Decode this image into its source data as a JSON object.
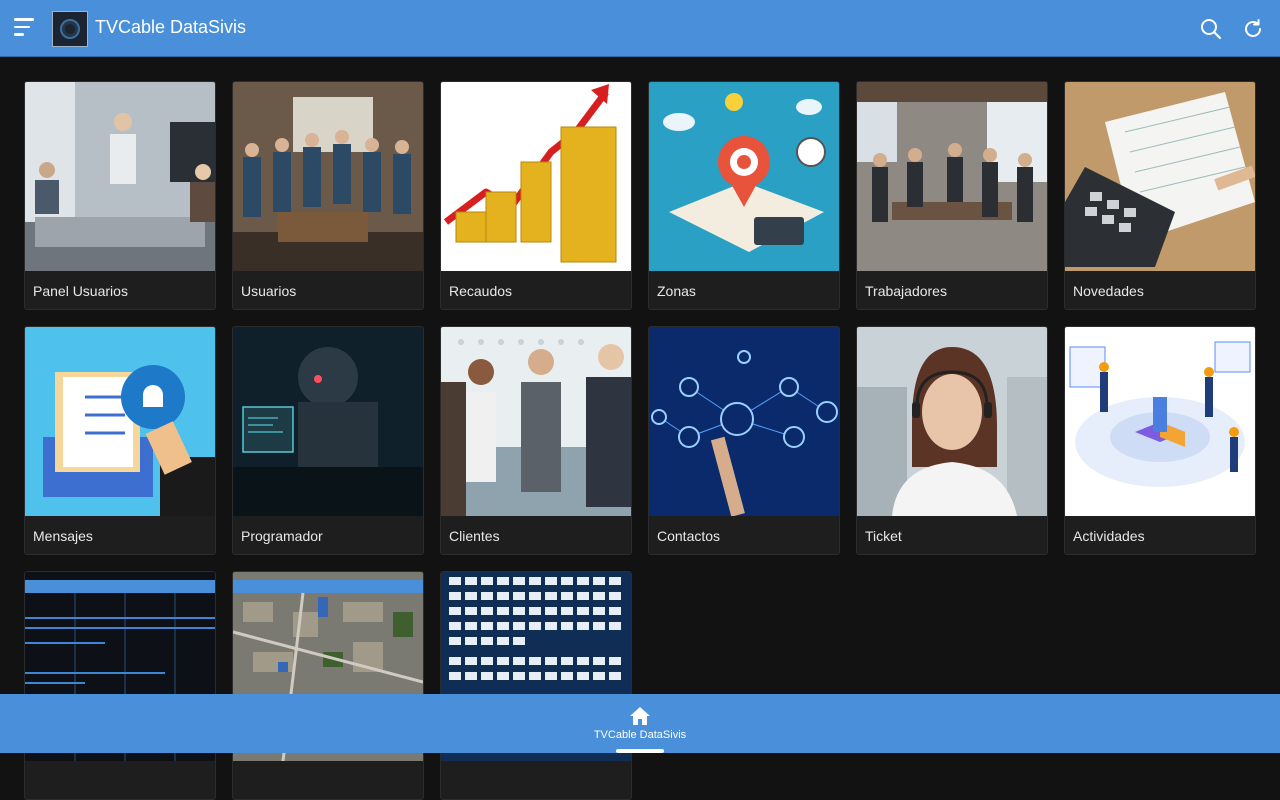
{
  "header": {
    "title": "TVCable DataSivis",
    "menu_icon": "menu-icon",
    "search_icon": "search-icon",
    "refresh_icon": "refresh-icon"
  },
  "cards": [
    {
      "label": "Panel Usuarios",
      "icon": "meeting-photo"
    },
    {
      "label": "Usuarios",
      "icon": "group-photo"
    },
    {
      "label": "Recaudos",
      "icon": "coins-chart"
    },
    {
      "label": "Zonas",
      "icon": "geo-location-map"
    },
    {
      "label": "Trabajadores",
      "icon": "office-workers-photo"
    },
    {
      "label": "Novedades",
      "icon": "calculator-notes"
    },
    {
      "label": "Mensajes",
      "icon": "notification-envelope"
    },
    {
      "label": "Programador",
      "icon": "robot-programmer"
    },
    {
      "label": "Clientes",
      "icon": "handshake-photo"
    },
    {
      "label": "Contactos",
      "icon": "network-contacts"
    },
    {
      "label": "Ticket",
      "icon": "support-agent"
    },
    {
      "label": "Actividades",
      "icon": "isometric-dashboard"
    },
    {
      "label": "",
      "icon": "data-table-screenshot"
    },
    {
      "label": "",
      "icon": "satellite-map"
    },
    {
      "label": "",
      "icon": "channel-grid"
    }
  ],
  "bottom_nav": {
    "home_label": "TVCable DataSivis",
    "home_icon": "home-icon"
  },
  "colors": {
    "primary": "#4a8fd9",
    "background": "#121212",
    "card": "#1e1e1e"
  }
}
